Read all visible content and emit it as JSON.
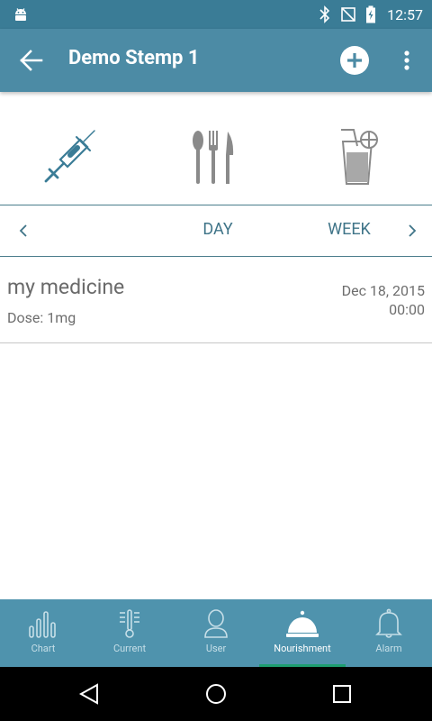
{
  "statusbar": {
    "time": "12:57"
  },
  "appbar": {
    "title": "Demo Stemp 1"
  },
  "categories": [
    "medication",
    "meal",
    "drink"
  ],
  "period_nav": {
    "day_label": "DAY",
    "week_label": "WEEK"
  },
  "entries": [
    {
      "name": "my medicine",
      "dose": "Dose: 1mg",
      "date": "Dec 18, 2015",
      "time": "00:00"
    }
  ],
  "bottom_nav": {
    "tabs": [
      {
        "label": "Chart",
        "icon": "bar-chart-icon",
        "active": false
      },
      {
        "label": "Current",
        "icon": "thermometer-icon",
        "active": false
      },
      {
        "label": "User",
        "icon": "user-icon",
        "active": false
      },
      {
        "label": "Nourishment",
        "icon": "cloche-icon",
        "active": true
      },
      {
        "label": "Alarm",
        "icon": "bell-icon",
        "active": false
      }
    ]
  },
  "colors": {
    "appbar": "#4c8ba5",
    "statusbar": "#3a7c96",
    "accent_text": "#3f7488",
    "bottom_nav": "#4f93ad",
    "active_indicator": "#1d9e70"
  }
}
